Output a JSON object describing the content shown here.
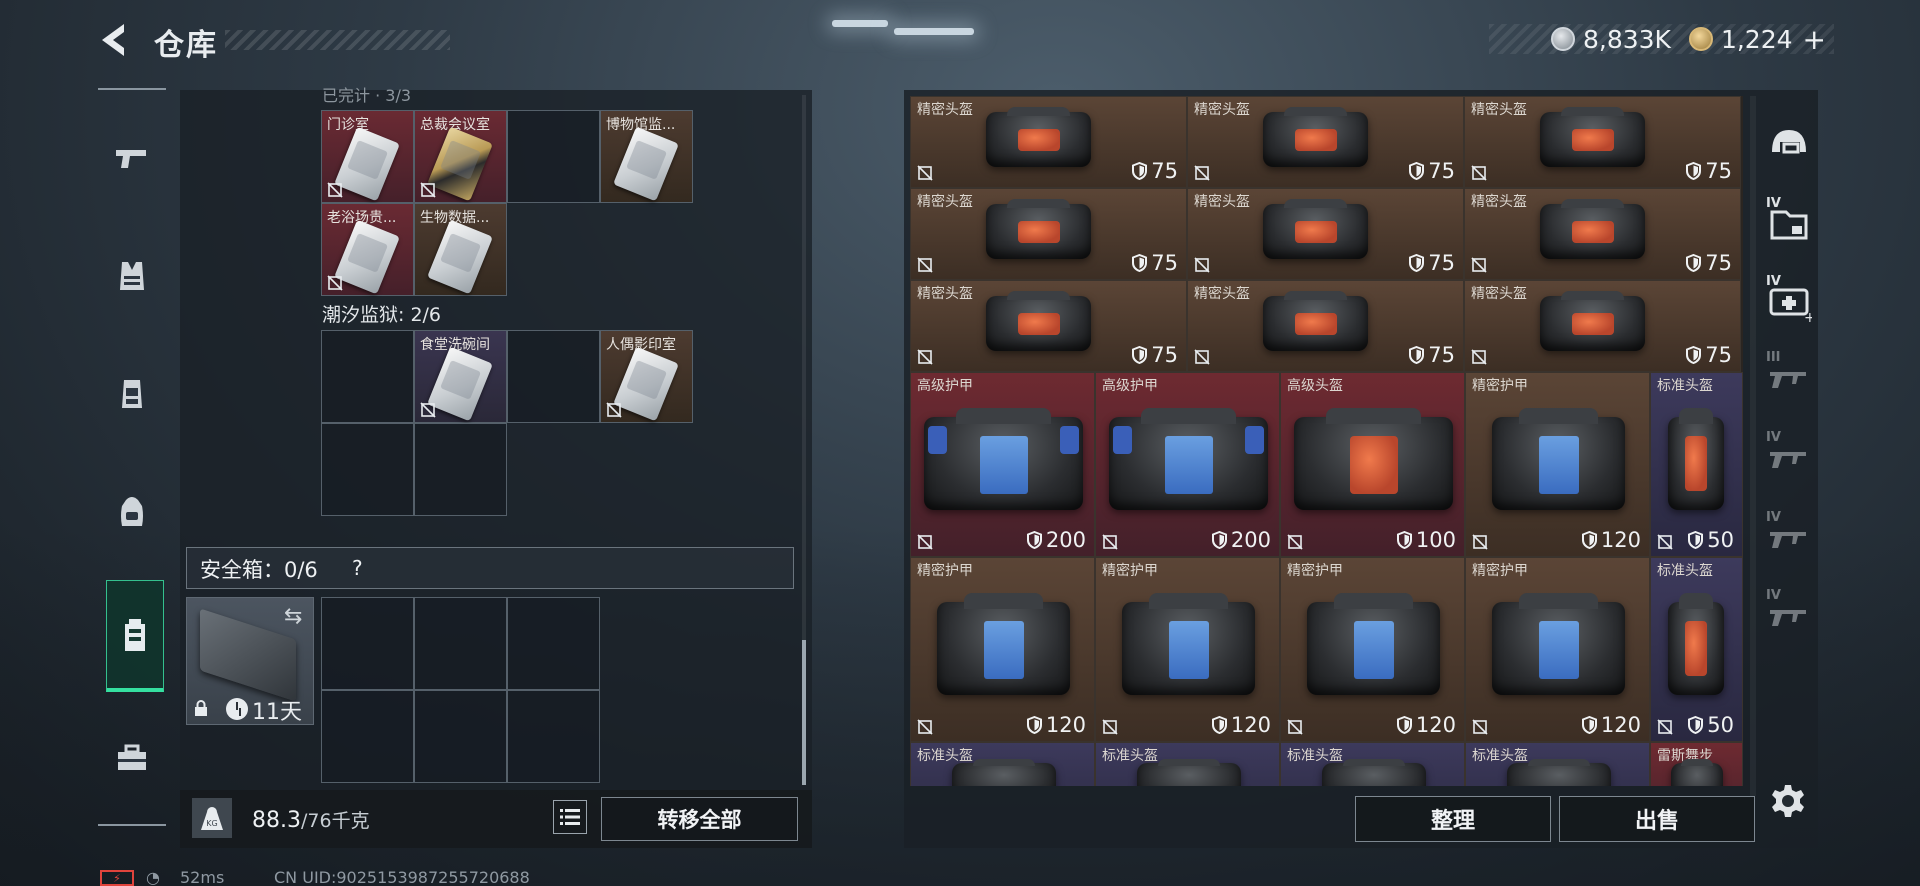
{
  "header": {
    "title": "仓库",
    "currency_1": "8,833K",
    "currency_2": "1,224",
    "add_label": "+"
  },
  "nav": {
    "items": [
      "pistol-icon",
      "armor-vest-icon",
      "chest-rig-icon",
      "backpack-icon",
      "safe-case-icon",
      "toolbox-icon"
    ],
    "active_index": 4
  },
  "stash": {
    "cutoff_label": "已完计 · 3/3",
    "section_1": {
      "items": [
        {
          "label": "门诊室",
          "rarity": "red"
        },
        {
          "label": "总裁会议室",
          "rarity": "red"
        },
        {
          "label": "",
          "rarity": "empty"
        },
        {
          "label": "博物馆监...",
          "rarity": "brown"
        },
        {
          "label": "老浴场贵...",
          "rarity": "red"
        },
        {
          "label": "生物数据...",
          "rarity": "brown"
        }
      ]
    },
    "section_2": {
      "title": "潮汐监狱: 2/6",
      "items": [
        {
          "label": "",
          "rarity": "empty"
        },
        {
          "label": "食堂洗碗间",
          "rarity": "violet"
        },
        {
          "label": "",
          "rarity": "empty"
        },
        {
          "label": "人偶影印室",
          "rarity": "brown"
        },
        {
          "label": "",
          "rarity": "empty"
        },
        {
          "label": "",
          "rarity": "empty"
        }
      ]
    },
    "safe": {
      "title": "安全箱：0/6",
      "help": "?",
      "duration": "11天"
    },
    "weight": {
      "current": "88.3",
      "capacity": "/76千克"
    },
    "transfer_all": "转移全部"
  },
  "inventory": {
    "rows": [
      {
        "cells": [
          {
            "name": "精密头盔",
            "durability": "75",
            "rarity": "brown"
          },
          {
            "name": "精密头盔",
            "durability": "75",
            "rarity": "brown"
          },
          {
            "name": "精密头盔",
            "durability": "75",
            "rarity": "brown"
          }
        ]
      },
      {
        "cells": [
          {
            "name": "精密头盔",
            "durability": "75",
            "rarity": "brown"
          },
          {
            "name": "精密头盔",
            "durability": "75",
            "rarity": "brown"
          },
          {
            "name": "精密头盔",
            "durability": "75",
            "rarity": "brown"
          }
        ]
      },
      {
        "cells": [
          {
            "name": "精密头盔",
            "durability": "75",
            "rarity": "brown"
          },
          {
            "name": "精密头盔",
            "durability": "75",
            "rarity": "brown"
          },
          {
            "name": "精密头盔",
            "durability": "75",
            "rarity": "brown"
          }
        ]
      }
    ],
    "large_row_1": [
      {
        "name": "高级护甲",
        "durability": "200",
        "rarity": "red"
      },
      {
        "name": "高级护甲",
        "durability": "200",
        "rarity": "red"
      },
      {
        "name": "高级头盔",
        "durability": "100",
        "rarity": "red"
      },
      {
        "name": "精密护甲",
        "durability": "120",
        "rarity": "brown"
      },
      {
        "name": "标准头盔",
        "durability": "50",
        "rarity": "violet"
      }
    ],
    "large_row_2": [
      {
        "name": "精密护甲",
        "durability": "120",
        "rarity": "brown"
      },
      {
        "name": "精密护甲",
        "durability": "120",
        "rarity": "brown"
      },
      {
        "name": "精密护甲",
        "durability": "120",
        "rarity": "brown"
      },
      {
        "name": "精密护甲",
        "durability": "120",
        "rarity": "brown"
      },
      {
        "name": "标准头盔",
        "durability": "50",
        "rarity": "violet"
      }
    ],
    "partial_row": [
      {
        "name": "标准头盔",
        "rarity": "violet"
      },
      {
        "name": "标准头盔",
        "rarity": "violet"
      },
      {
        "name": "标准头盔",
        "rarity": "violet"
      },
      {
        "name": "标准头盔",
        "rarity": "violet"
      },
      {
        "name": "雷斯舞步",
        "rarity": "red"
      }
    ],
    "sort_label": "整理",
    "sell_label": "出售"
  },
  "side_tabs": [
    {
      "icon": "helmet-icon",
      "tier": ""
    },
    {
      "icon": "folder-icon",
      "tier": "IV"
    },
    {
      "icon": "medkit-icon",
      "tier": "IV"
    },
    {
      "icon": "rifle-icon",
      "tier": "III"
    },
    {
      "icon": "rifle-icon",
      "tier": "IV"
    },
    {
      "icon": "rifle-icon",
      "tier": "IV"
    },
    {
      "icon": "rifle-icon",
      "tier": "IV"
    }
  ],
  "status": {
    "ping": "52ms",
    "uid": "CN UID:9025153987255720688"
  },
  "colors": {
    "accent": "#35e0a0",
    "rarity_red": "#6e2a31",
    "rarity_brown": "#5b4536",
    "rarity_violet": "#3d3a5c"
  }
}
